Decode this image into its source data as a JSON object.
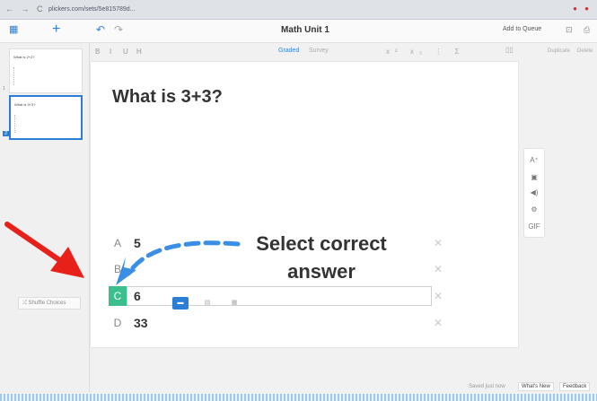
{
  "browser": {
    "nav": "← → C",
    "url": "plickers.com/sets/5e815789d...",
    "ext": "● ●"
  },
  "app": {
    "title": "Math Unit 1",
    "add_to_queue": "Add to Queue",
    "plus": "+",
    "undo": "↶",
    "redo": "↷"
  },
  "toolbar": {
    "bold": "B",
    "italic": "I",
    "underline": "U",
    "heading": "H",
    "graded": "Graded",
    "survey": "Survey",
    "math": "x² x₂ ⋮ Σ",
    "layout": "▯▯",
    "duplicate": "Duplicate",
    "delete": "Delete"
  },
  "sidebar": {
    "slides": [
      {
        "num": "1",
        "title": "What is 2+2?",
        "selected": false
      },
      {
        "num": "2",
        "title": "What is 3+3?",
        "selected": true
      }
    ]
  },
  "question": {
    "text": "What is 3+3?"
  },
  "choices": [
    {
      "letter": "A",
      "text": "5",
      "correct": false
    },
    {
      "letter": "B",
      "text": "",
      "correct": false
    },
    {
      "letter": "C",
      "text": "6",
      "correct": true
    },
    {
      "letter": "D",
      "text": "33",
      "correct": false
    }
  ],
  "shuffle": "⤮ Shuffle Choices",
  "layout_options": [
    "▬",
    "▤",
    "▦"
  ],
  "tools": [
    "A⁺",
    "▣",
    "◀)",
    "⚙",
    "GIF"
  ],
  "status": {
    "saved": "Saved just now",
    "whats_new": "What's New",
    "feedback": "Feedback"
  },
  "annotation": {
    "line1": "Select correct",
    "line2": "answer",
    "arrow_color": "#3a8ee6",
    "pointer_color": "#e8201a"
  },
  "colors": {
    "accent": "#2a7fd4",
    "correct": "#3bbf8c"
  }
}
